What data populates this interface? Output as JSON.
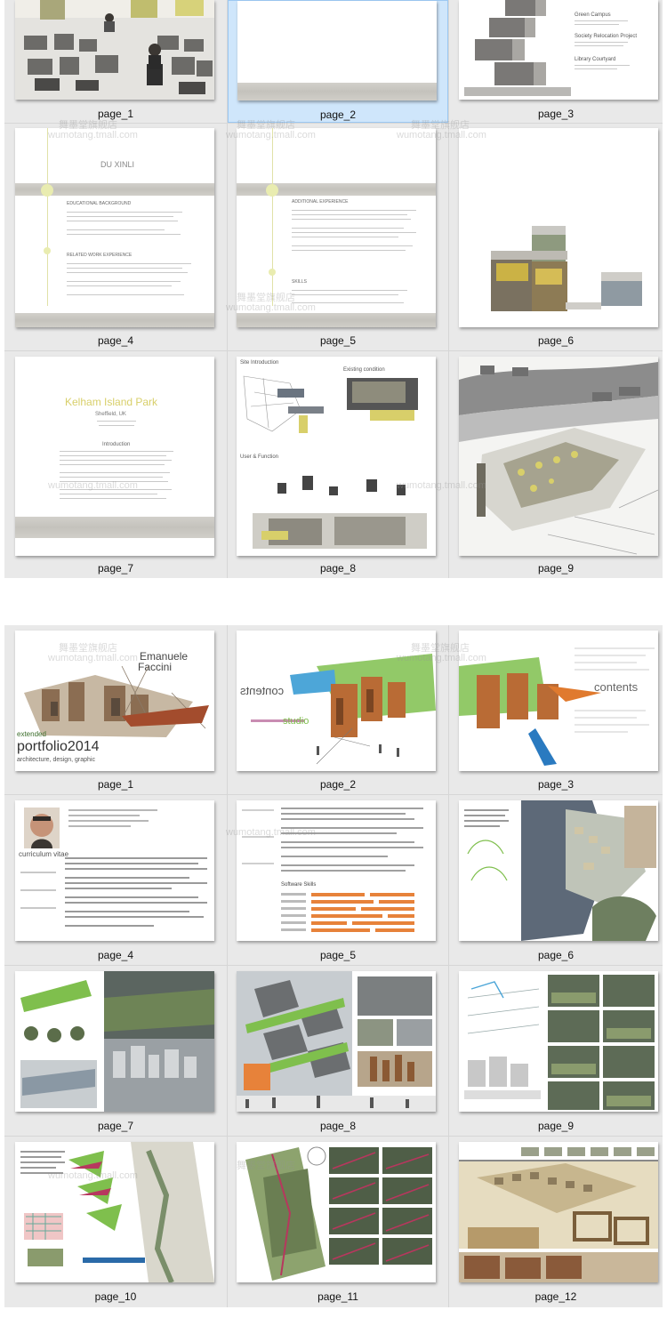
{
  "grid1": {
    "pages": [
      {
        "label": "page_1",
        "selected": false
      },
      {
        "label": "page_2",
        "selected": true
      },
      {
        "label": "page_3",
        "selected": false
      },
      {
        "label": "page_4",
        "selected": false
      },
      {
        "label": "page_5",
        "selected": false
      },
      {
        "label": "page_6",
        "selected": false
      },
      {
        "label": "page_7",
        "selected": false
      },
      {
        "label": "page_8",
        "selected": false
      },
      {
        "label": "page_9",
        "selected": false
      }
    ],
    "thumb_text": {
      "p3_items": [
        "Green Campus",
        "Society Relocation Project",
        "Library Courtyard"
      ],
      "p4_name": "DU XINLI",
      "p4_sec1": "EDUCATIONAL BACKGROUND",
      "p4_sec2": "RELATED WORK EXPERIENCE",
      "p5_sec1": "ADDITIONAL EXPERIENCE",
      "p5_sec2": "SKILLS",
      "p7_title": "Kelham Island Park",
      "p7_sub": "Sheffield, UK",
      "p7_intro": "Introduction",
      "p8_h1": "Site Introduction",
      "p8_h2": "Existing condition",
      "p8_h3": "User & Function"
    }
  },
  "grid2": {
    "pages": [
      {
        "label": "page_1"
      },
      {
        "label": "page_2"
      },
      {
        "label": "page_3"
      },
      {
        "label": "page_4"
      },
      {
        "label": "page_5"
      },
      {
        "label": "page_6"
      },
      {
        "label": "page_7"
      },
      {
        "label": "page_8"
      },
      {
        "label": "page_9"
      },
      {
        "label": "page_10"
      },
      {
        "label": "page_11"
      },
      {
        "label": "page_12"
      }
    ],
    "thumb_text": {
      "p1_name1": "Emanuele",
      "p1_name2": "Faccini",
      "p1_portfolio": "portfolio2014",
      "p1_extended": "extended",
      "p1_sub": "architecture, design, graphic",
      "p2_contents": "contents",
      "p2_studio": "studio",
      "p3_contents": "contents",
      "p4_cv": "curriculum vitae",
      "p5_software": "Software Skills"
    }
  },
  "watermark": {
    "line1": "舞墨堂旗舰店",
    "line2": "wumotang.tmall.com"
  },
  "colors": {
    "panel": "#e9e9e9",
    "selected": "#cfe6fb",
    "accent_yellow": "#d8cf6a"
  }
}
